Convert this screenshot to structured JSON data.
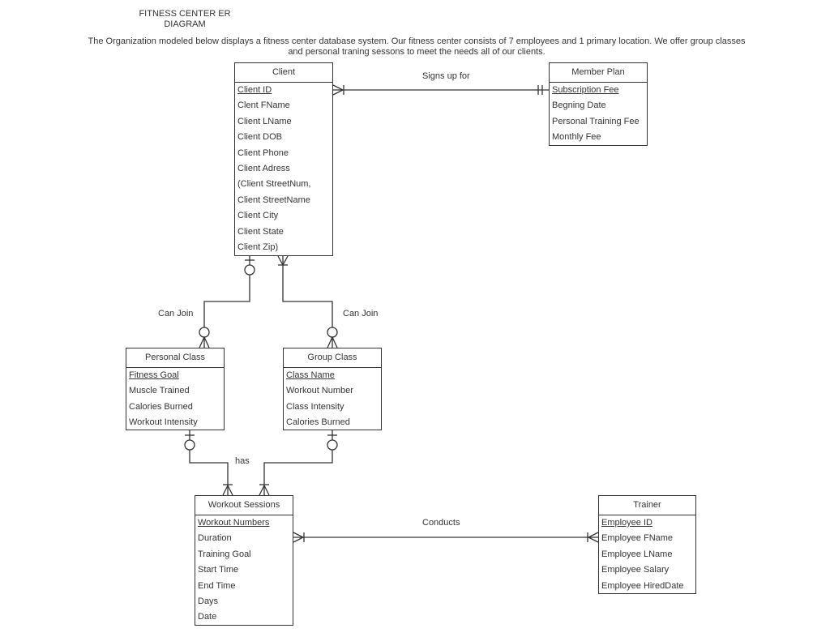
{
  "title": "FITNESS CENTER ER DIAGRAM",
  "description": "The Organization modeled below displays a fitness center database system. Our fitness center consists of 7 employees and 1 primary location. We offer group classes and personal traning sessons to meet the needs all of our clients.",
  "entities": {
    "client": {
      "name": "Client",
      "attributes": [
        {
          "label": "Client ID",
          "pk": true
        },
        {
          "label": "Clent FName"
        },
        {
          "label": "Client LName"
        },
        {
          "label": "Client DOB"
        },
        {
          "label": "Client Phone"
        },
        {
          "label": "Client Adress"
        },
        {
          "label": "(Client StreetNum,"
        },
        {
          "label": "Client StreetName"
        },
        {
          "label": "Client City"
        },
        {
          "label": "Client State"
        },
        {
          "label": "Client Zip)"
        }
      ]
    },
    "member_plan": {
      "name": "Member Plan",
      "attributes": [
        {
          "label": "Subscription Fee",
          "pk": true
        },
        {
          "label": "Begning  Date"
        },
        {
          "label": "Personal Training Fee"
        },
        {
          "label": "Monthly Fee"
        }
      ]
    },
    "personal_class": {
      "name": "Personal Class",
      "attributes": [
        {
          "label": "Fitness Goal",
          "pk": true
        },
        {
          "label": "Muscle Trained"
        },
        {
          "label": "Calories Burned"
        },
        {
          "label": "Workout Intensity"
        }
      ]
    },
    "group_class": {
      "name": "Group Class",
      "attributes": [
        {
          "label": "Class Name",
          "pk": true
        },
        {
          "label": "Workout Number"
        },
        {
          "label": "Class Intensity"
        },
        {
          "label": "Calories Burned"
        }
      ]
    },
    "workout_sessions": {
      "name": "Workout Sessions",
      "attributes": [
        {
          "label": "Workout Numbers",
          "pk": true
        },
        {
          "label": "Duration"
        },
        {
          "label": "Training Goal"
        },
        {
          "label": "Start Time"
        },
        {
          "label": "End Time"
        },
        {
          "label": "Days"
        },
        {
          "label": "Date"
        }
      ]
    },
    "trainer": {
      "name": "Trainer",
      "attributes": [
        {
          "label": "Employee ID",
          "pk": true
        },
        {
          "label": "Employee FName"
        },
        {
          "label": "Employee LName"
        },
        {
          "label": "Employee Salary"
        },
        {
          "label": "Employee HiredDate"
        }
      ]
    }
  },
  "relationships": {
    "signs_up_for": {
      "label": "Signs up for",
      "from": "Client",
      "to": "Member Plan",
      "from_cardinality": "one-or-many",
      "to_cardinality": "one-and-only-one"
    },
    "can_join_personal": {
      "label": "Can Join",
      "from": "Client",
      "to": "Personal Class",
      "from_cardinality": "zero-or-one",
      "to_cardinality": "zero-or-many"
    },
    "can_join_group": {
      "label": "Can Join",
      "from": "Client",
      "to": "Group Class",
      "from_cardinality": "one-or-many",
      "to_cardinality": "zero-or-many"
    },
    "has": {
      "label": "has",
      "from": [
        "Personal Class",
        "Group Class"
      ],
      "to": "Workout Sessions",
      "from_cardinality": "zero-or-one",
      "to_cardinality": "one-or-many"
    },
    "conducts": {
      "label": "Conducts",
      "from": "Workout Sessions",
      "to": "Trainer",
      "from_cardinality": "one-or-many",
      "to_cardinality": "one-or-many"
    }
  }
}
